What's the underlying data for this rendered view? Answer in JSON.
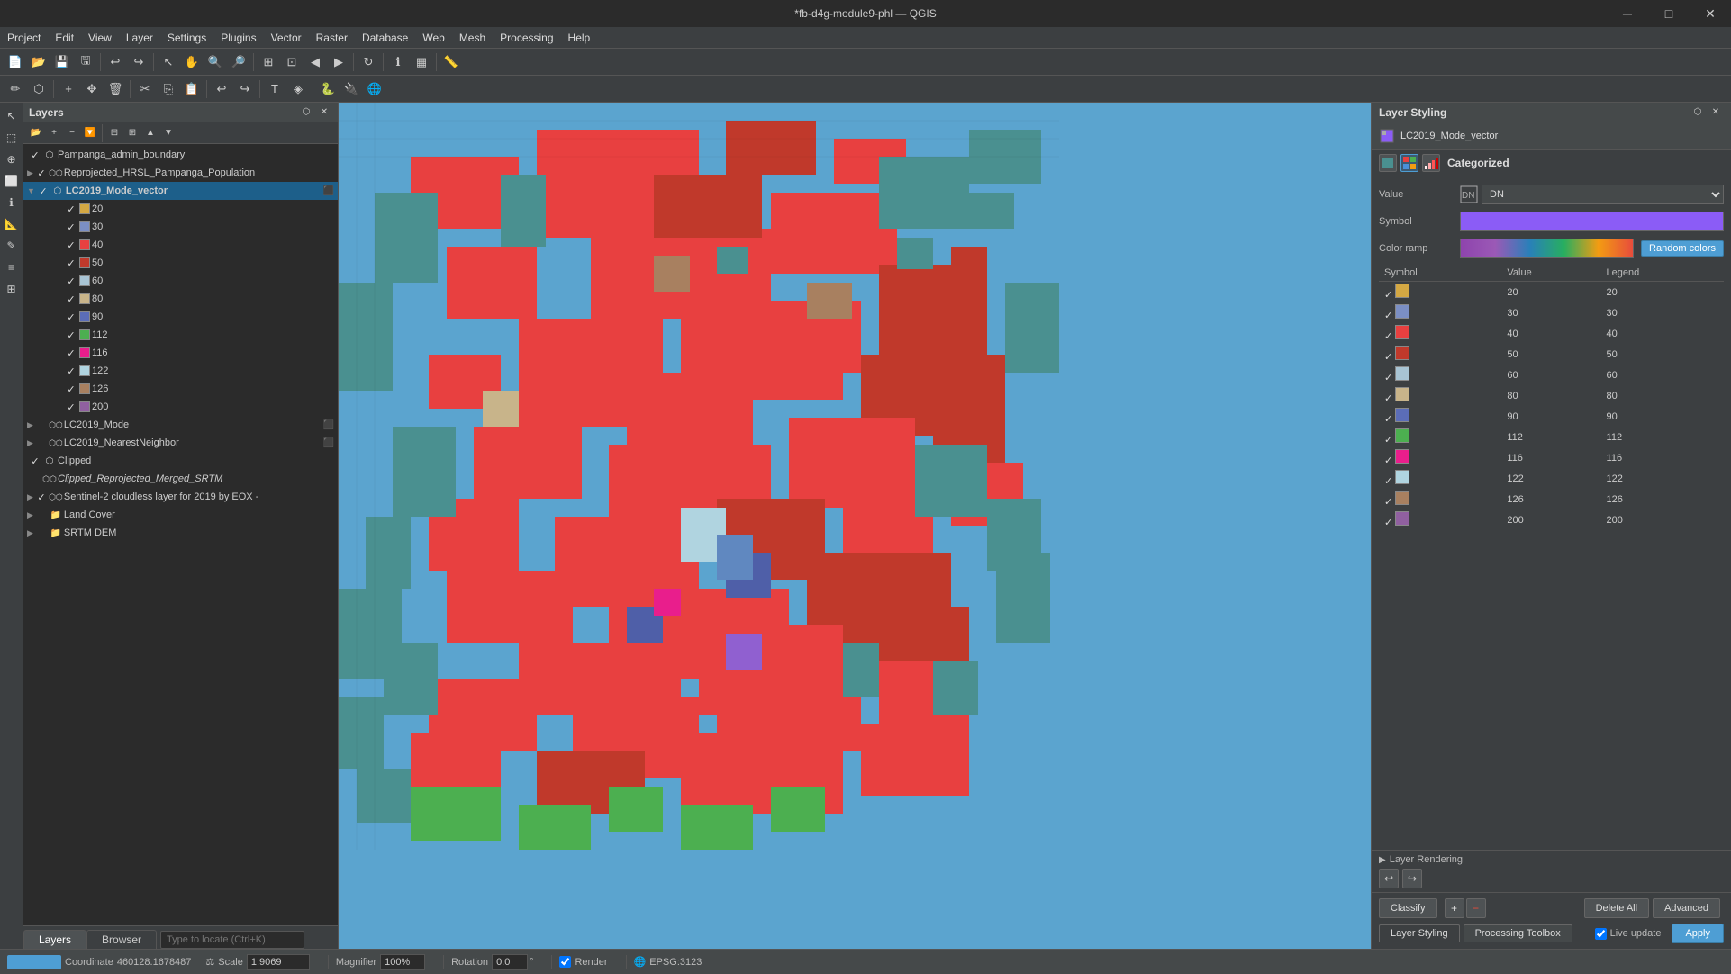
{
  "titlebar": {
    "title": "*fb-d4g-module9-phl — QGIS"
  },
  "menubar": {
    "items": [
      "Project",
      "Edit",
      "View",
      "Layer",
      "Settings",
      "Plugins",
      "Vector",
      "Raster",
      "Database",
      "Web",
      "Mesh",
      "Processing",
      "Help"
    ]
  },
  "layers_panel": {
    "title": "Layers",
    "layers": [
      {
        "id": "pampanga-admin",
        "indent": 0,
        "checked": true,
        "name": "Pampanga_admin_boundary",
        "type": "vector",
        "color": null
      },
      {
        "id": "reprojected-hrsl",
        "indent": 0,
        "checked": true,
        "expand": true,
        "name": "Reprojected_HRSL_Pampanga_Population",
        "type": "raster",
        "color": null
      },
      {
        "id": "lc2019-mode-vector",
        "indent": 0,
        "checked": true,
        "expand": true,
        "name": "LC2019_Mode_vector",
        "type": "vector",
        "color": null,
        "selected": true
      },
      {
        "id": "lc-20",
        "indent": 3,
        "checked": true,
        "color": "#d4a843",
        "name": "20"
      },
      {
        "id": "lc-30",
        "indent": 3,
        "checked": true,
        "color": "#7b8fc4",
        "name": "30"
      },
      {
        "id": "lc-40",
        "indent": 3,
        "checked": true,
        "color": "#e84040",
        "name": "40"
      },
      {
        "id": "lc-50",
        "indent": 3,
        "checked": true,
        "color": "#c0392b",
        "name": "50"
      },
      {
        "id": "lc-60",
        "indent": 3,
        "checked": true,
        "color": "#a8c4d4",
        "name": "60"
      },
      {
        "id": "lc-80",
        "indent": 3,
        "checked": true,
        "color": "#c8b48a",
        "name": "80"
      },
      {
        "id": "lc-90",
        "indent": 3,
        "checked": true,
        "color": "#5b6db8",
        "name": "90"
      },
      {
        "id": "lc-112",
        "indent": 3,
        "checked": true,
        "color": "#4caf50",
        "name": "112"
      },
      {
        "id": "lc-116",
        "indent": 3,
        "checked": true,
        "color": "#e91e8c",
        "name": "116"
      },
      {
        "id": "lc-122",
        "indent": 3,
        "checked": true,
        "color": "#b0d4e0",
        "name": "122"
      },
      {
        "id": "lc-126",
        "indent": 3,
        "checked": true,
        "color": "#a88060",
        "name": "126"
      },
      {
        "id": "lc-200",
        "indent": 3,
        "checked": true,
        "color": "#9060a0",
        "name": "200"
      },
      {
        "id": "lc2019-mode",
        "indent": 0,
        "checked": false,
        "expand": false,
        "name": "LC2019_Mode",
        "type": "raster",
        "color": null
      },
      {
        "id": "lc2019-nearest",
        "indent": 0,
        "checked": false,
        "expand": false,
        "name": "LC2019_NearestNeighbor",
        "type": "raster",
        "color": null
      },
      {
        "id": "clipped",
        "indent": 0,
        "checked": true,
        "name": "Clipped",
        "type": "vector",
        "color": null
      },
      {
        "id": "clipped-reprojected",
        "indent": 0,
        "checked": false,
        "italic": true,
        "name": "Clipped_Reprojected_Merged_SRTM",
        "type": "raster",
        "color": null
      },
      {
        "id": "sentinel2",
        "indent": 0,
        "checked": true,
        "expand": true,
        "name": "Sentinel-2 cloudless layer for 2019 by EOX -",
        "type": "raster",
        "color": null
      },
      {
        "id": "land-cover",
        "indent": 0,
        "checked": false,
        "expand": false,
        "name": "Land Cover",
        "type": "group",
        "color": null
      },
      {
        "id": "srtm-dem",
        "indent": 0,
        "checked": false,
        "expand": false,
        "name": "SRTM DEM",
        "type": "group",
        "color": null
      }
    ]
  },
  "styling_panel": {
    "title": "Layer Styling",
    "layer_name": "LC2019_Mode_vector",
    "renderer": "Categorized",
    "value_label": "Value",
    "value": "DN",
    "symbol_label": "Symbol",
    "color_ramp_label": "Color ramp",
    "color_ramp_btn": "Random colors",
    "legend_columns": [
      "Symbol",
      "Value",
      "Legend"
    ],
    "legend_items": [
      {
        "checked": true,
        "color": "#d4a843",
        "value": "20",
        "legend": "20"
      },
      {
        "checked": true,
        "color": "#7b8fc4",
        "value": "30",
        "legend": "30"
      },
      {
        "checked": true,
        "color": "#e84040",
        "value": "40",
        "legend": "40"
      },
      {
        "checked": true,
        "color": "#c0392b",
        "value": "50",
        "legend": "50"
      },
      {
        "checked": true,
        "color": "#a8c4d4",
        "value": "60",
        "legend": "60"
      },
      {
        "checked": true,
        "color": "#c8b48a",
        "value": "80",
        "legend": "80"
      },
      {
        "checked": true,
        "color": "#5b6db8",
        "value": "90",
        "legend": "90"
      },
      {
        "checked": true,
        "color": "#4caf50",
        "value": "112",
        "legend": "112"
      },
      {
        "checked": true,
        "color": "#e91e8c",
        "value": "116",
        "legend": "116"
      },
      {
        "checked": true,
        "color": "#b0d4e0",
        "value": "122",
        "legend": "122"
      },
      {
        "checked": true,
        "color": "#a88060",
        "value": "126",
        "legend": "126"
      },
      {
        "checked": true,
        "color": "#9060a0",
        "value": "200",
        "legend": "200"
      }
    ],
    "footer": {
      "classify_btn": "Classify",
      "delete_all_btn": "Delete All",
      "advanced_btn": "Advanced",
      "layer_rendering_label": "Layer Rendering",
      "live_update_label": "Live update",
      "apply_btn": "Apply"
    },
    "tabs": [
      "Layer Styling",
      "Processing Toolbox"
    ]
  },
  "statusbar": {
    "coordinate_label": "Coordinate",
    "coordinate_value": "460128.1678487",
    "scale_label": "Scale",
    "scale_value": "1:9069",
    "magnifier_label": "Magnifier",
    "magnifier_value": "100%",
    "rotation_label": "Rotation",
    "rotation_value": "0.0",
    "render_label": "Render",
    "epsg_label": "EPSG:3123"
  },
  "bottom_panel": {
    "tabs": [
      "Layers",
      "Browser"
    ],
    "active_tab": "Layers",
    "search_placeholder": "Type to locate (Ctrl+K)"
  },
  "icons": {
    "expand": "▶",
    "collapse": "▼",
    "check": "✓",
    "close": "✕",
    "minimize": "─",
    "maximize": "□",
    "arrow_right": "▶",
    "arrow_down": "▼"
  }
}
